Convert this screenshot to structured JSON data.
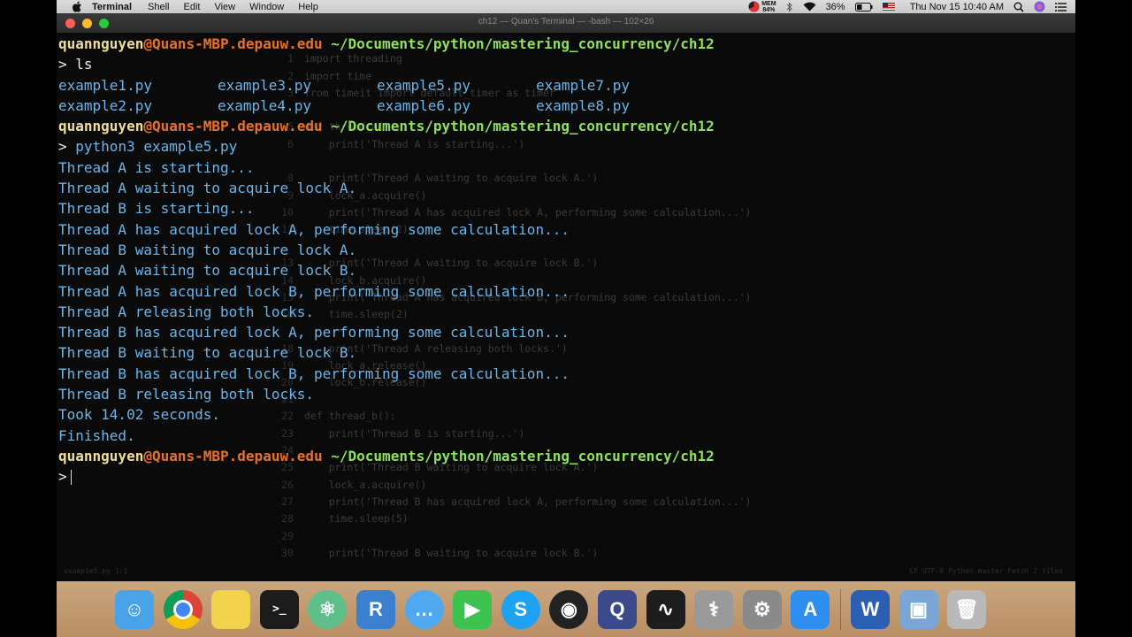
{
  "menubar": {
    "app_name": "Terminal",
    "menus": [
      "Shell",
      "Edit",
      "View",
      "Window",
      "Help"
    ],
    "mem_label": "MEM",
    "mem_value": "84%",
    "battery": "36%",
    "datetime": "Thu Nov 15  10:40 AM"
  },
  "window": {
    "title": "ch12 — Quan's Terminal — -bash — 102×26"
  },
  "terminal": {
    "prompt": {
      "user": "quannguyen",
      "at_host": "@Quans-MBP.depauw.edu",
      "path": " ~/Documents/python/mastering_concurrency/ch12",
      "marker": ">"
    },
    "commands": {
      "ls": " ls",
      "run": " python3 example5.py"
    },
    "files": [
      [
        "example1.py",
        "example3.py",
        "example5.py",
        "example7.py"
      ],
      [
        "example2.py",
        "example4.py",
        "example6.py",
        "example8.py"
      ]
    ],
    "output": [
      "Thread A is starting...",
      "Thread A waiting to acquire lock A.",
      "Thread B is starting...",
      "Thread A has acquired lock A, performing some calculation...",
      "Thread B waiting to acquire lock A.",
      "Thread A waiting to acquire lock B.",
      "Thread A has acquired lock B, performing some calculation...",
      "Thread A releasing both locks.",
      "Thread B has acquired lock A, performing some calculation...",
      "Thread B waiting to acquire lock B.",
      "Thread B has acquired lock B, performing some calculation...",
      "Thread B releasing both locks.",
      "Took 14.02 seconds.",
      "Finished."
    ]
  },
  "ghost_editor": {
    "lines": [
      {
        "n": "1",
        "code": "import threading"
      },
      {
        "n": "2",
        "code": "import time"
      },
      {
        "n": "3",
        "code": "from timeit import default_timer as timer"
      },
      {
        "n": "5",
        "code": "def thread_a():"
      },
      {
        "n": "6",
        "code": "    print('Thread A is starting...')"
      },
      {
        "n": "8",
        "code": "    print('Thread A waiting to acquire lock A.')"
      },
      {
        "n": "9",
        "code": "    lock_a.acquire()"
      },
      {
        "n": "10",
        "code": "    print('Thread A has acquired lock A, performing some calculation...')"
      },
      {
        "n": "11",
        "code": "    time.sleep(2)"
      },
      {
        "n": "13",
        "code": "    print('Thread A waiting to acquire lock B.')"
      },
      {
        "n": "14",
        "code": "    lock_b.acquire()"
      },
      {
        "n": "15",
        "code": "    print('Thread A has acquired lock B, performing some calculation...')"
      },
      {
        "n": "16",
        "code": "    time.sleep(2)"
      },
      {
        "n": "18",
        "code": "    print('Thread A releasing both locks.')"
      },
      {
        "n": "19",
        "code": "    lock_a.release()"
      },
      {
        "n": "20",
        "code": "    lock_b.release()"
      },
      {
        "n": "21",
        "code": ""
      },
      {
        "n": "22",
        "code": "def thread_b():"
      },
      {
        "n": "23",
        "code": "    print('Thread B is starting...')"
      },
      {
        "n": "24",
        "code": ""
      },
      {
        "n": "25",
        "code": "    print('Thread B waiting to acquire lock A.')"
      },
      {
        "n": "26",
        "code": "    lock_a.acquire()"
      },
      {
        "n": "27",
        "code": "    print('Thread B has acquired lock A, performing some calculation...')"
      },
      {
        "n": "28",
        "code": "    time.sleep(5)"
      },
      {
        "n": "29",
        "code": ""
      },
      {
        "n": "30",
        "code": "    print('Thread B waiting to acquire lock B.')"
      }
    ],
    "status_left": "example5.py  1:1",
    "status_right": "LF  UTF-8  Python  master  Fetch  2 files"
  },
  "dock": {
    "apps": [
      {
        "name": "finder",
        "glyph": "☺",
        "color": "#4aa3e8"
      },
      {
        "name": "chrome",
        "glyph": "",
        "color": "#e8e8e8"
      },
      {
        "name": "stickies",
        "glyph": "",
        "color": "#f2d14b"
      },
      {
        "name": "terminal",
        "glyph": ">_",
        "color": "#1c1c1c"
      },
      {
        "name": "atom",
        "glyph": "⚛",
        "color": "#5fbf8a"
      },
      {
        "name": "r",
        "glyph": "R",
        "color": "#3b7fd0"
      },
      {
        "name": "messages",
        "glyph": "…",
        "color": "#4fa8f0"
      },
      {
        "name": "facetime",
        "glyph": "▶",
        "color": "#3dc24f"
      },
      {
        "name": "skype",
        "glyph": "S",
        "color": "#1da1f2"
      },
      {
        "name": "obs",
        "glyph": "◉",
        "color": "#222222"
      },
      {
        "name": "quicktime",
        "glyph": "Q",
        "color": "#3b4a8a"
      },
      {
        "name": "activity-monitor",
        "glyph": "∿",
        "color": "#1d1d1d"
      },
      {
        "name": "disk-utility",
        "glyph": "⚕",
        "color": "#9a9a9a"
      },
      {
        "name": "system-preferences",
        "glyph": "⚙",
        "color": "#8a8a8a"
      },
      {
        "name": "app-store",
        "glyph": "A",
        "color": "#2e8ff0"
      },
      {
        "name": "word",
        "glyph": "W",
        "color": "#2b5fb3"
      },
      {
        "name": "preview",
        "glyph": "▣",
        "color": "#7aa6d6"
      },
      {
        "name": "trash",
        "glyph": "🗑",
        "color": "#b9b9b9"
      }
    ]
  }
}
